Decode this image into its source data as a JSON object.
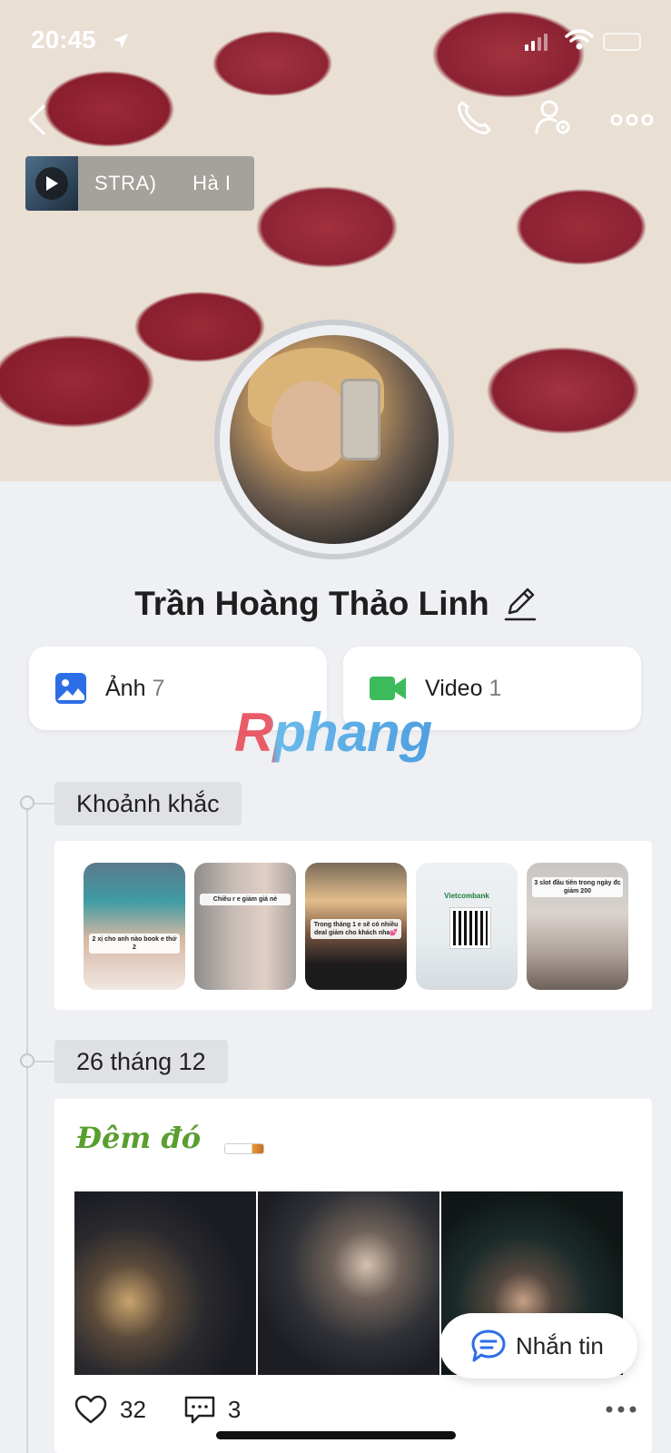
{
  "status_bar": {
    "time": "20:45"
  },
  "music": {
    "text": "STRA)      Hà I"
  },
  "profile": {
    "name": "Trần Hoàng Thảo Linh"
  },
  "media": {
    "photos": {
      "label": "Ảnh",
      "count": "7"
    },
    "videos": {
      "label": "Video",
      "count": "1"
    }
  },
  "watermark": "Rphang",
  "timeline": {
    "moments_label": "Khoảnh khắc",
    "moments": [
      {
        "caption": "2 xị cho anh nào book e thứ 2"
      },
      {
        "caption": "Chiều r e giảm giá nè"
      },
      {
        "caption": "Trong tháng 1 e sẽ có nhiều deal giảm cho khách nha💕"
      },
      {
        "caption": "Vietcombank"
      },
      {
        "caption": "3 slot đầu tiên trong ngày đc giảm 200"
      }
    ],
    "date_label": "26 tháng 12",
    "post": {
      "title": "Đêm đó",
      "likes": "32",
      "comments": "3"
    }
  },
  "chat_button": {
    "label": "Nhắn tin"
  },
  "colors": {
    "accent_blue": "#2d6ee6",
    "video_green": "#3dbb5c",
    "post_title_green": "#5a9e2e"
  }
}
